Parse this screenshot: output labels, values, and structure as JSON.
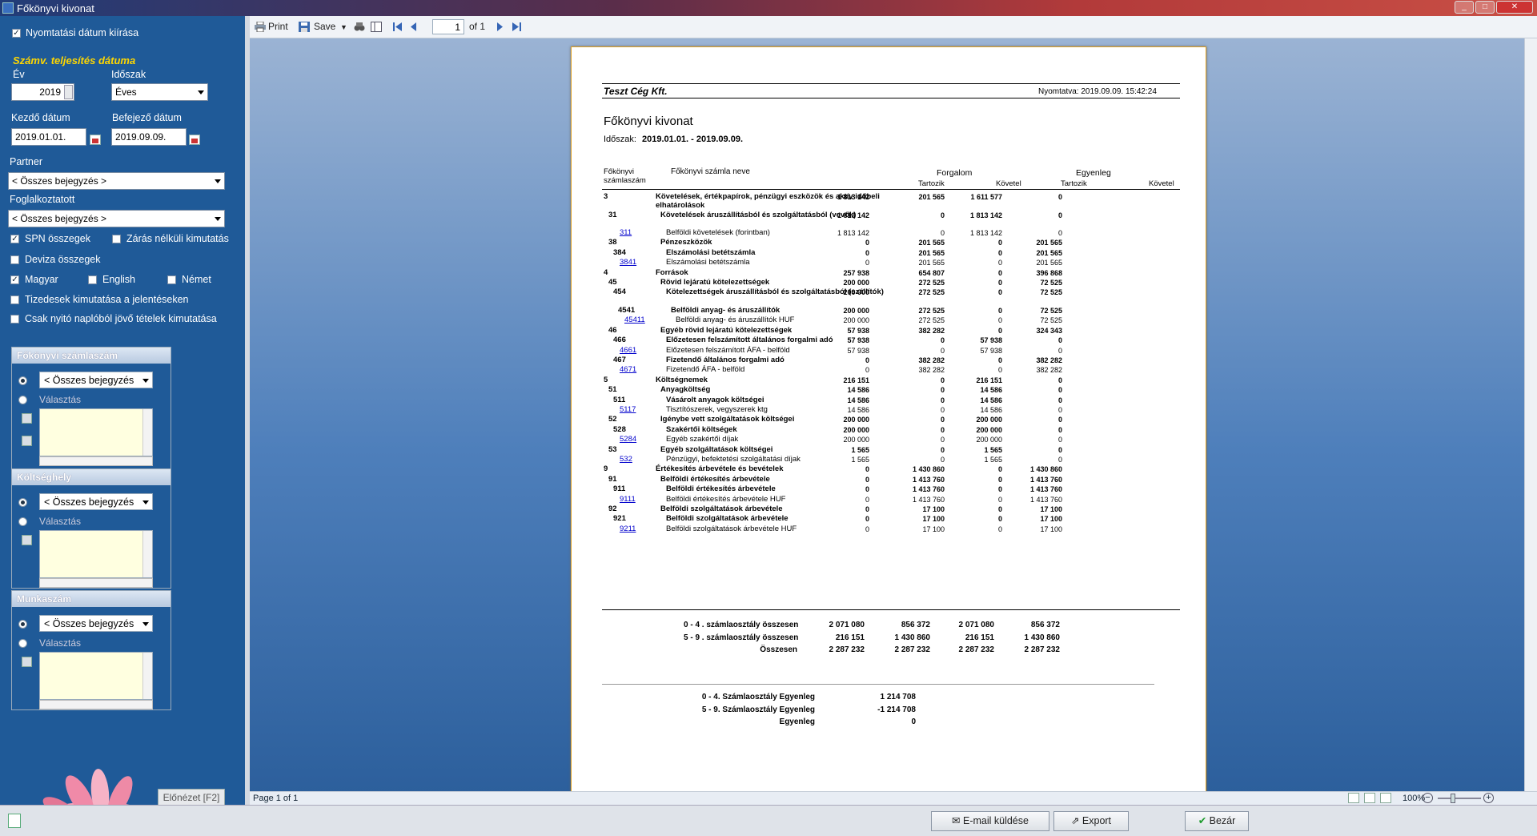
{
  "window": {
    "title": "Főkönyvi kivonat"
  },
  "left": {
    "print_date_label": "Nyomtatási dátum kiírása",
    "section_title": "Számv. teljesítés dátuma",
    "year_label": "Év",
    "year_value": "2019",
    "period_label": "Időszak",
    "period_value": "Éves",
    "start_label": "Kezdő dátum",
    "start_value": "2019.01.01.",
    "end_label": "Befejező dátum",
    "end_value": "2019.09.09.",
    "partner_label": "Partner",
    "partner_value": "< Összes bejegyzés >",
    "employee_label": "Foglalkoztatott",
    "employee_value": "< Összes bejegyzés >",
    "spn_label": "SPN összegek",
    "nonclose_label": "Zárás nélküli kimutatás",
    "currency_label": "Deviza összegek",
    "lang_hu": "Magyar",
    "lang_en": "English",
    "lang_de": "Német",
    "decimals_label": "Tizedesek kimutatása a jelentéseken",
    "opening_label": "Csak nyitó naplóból jövő tételek kimutatása",
    "groups": [
      {
        "title": "Főkönyvi számlaszám",
        "select": "< Összes bejegyzés",
        "choice": "Választás"
      },
      {
        "title": "Költséghely",
        "select": "< Összes bejegyzés",
        "choice": "Választás"
      },
      {
        "title": "Munkaszám",
        "select": "< Összes bejegyzés",
        "choice": "Választás"
      }
    ],
    "preview_button": "Előnézet [F2]"
  },
  "toolbar": {
    "print": "Print",
    "save": "Save",
    "page_value": "1",
    "page_of": "of 1"
  },
  "status": {
    "page": "Page 1 of 1",
    "zoom": "100%"
  },
  "report": {
    "company": "Teszt Cég Kft.",
    "printed": "Nyomtatva: 2019.09.09. 15:42:24",
    "title": "Főkönyvi kivonat",
    "period_label": "Időszak:",
    "period_value": "2019.01.01. - 2019.09.09.",
    "col_account": "Főkönyvi számlaszám",
    "col_name": "Főkönyvi számla neve",
    "col_turnover": "Forgalom",
    "col_balance": "Egyenleg",
    "col_debit": "Tartozik",
    "col_credit": "Követel",
    "rows": [
      {
        "code": "3",
        "name": "Követelések, értékpapírok, pénzügyi eszközök és aktív időbeli elhatárolások",
        "v": [
          "1 813 142",
          "201 565",
          "1 611 577",
          "0"
        ],
        "lvl": 0,
        "two": true
      },
      {
        "code": "31",
        "name": "Követelések áruszállításból és szolgáltatásból (vevők)",
        "v": [
          "1 813 142",
          "0",
          "1 813 142",
          "0"
        ],
        "lvl": 1,
        "two": true
      },
      {
        "code": "311",
        "name": "Belföldi követelések (forintban)",
        "v": [
          "1 813 142",
          "0",
          "1 813 142",
          "0"
        ],
        "lvl": 9
      },
      {
        "code": "38",
        "name": "Pénzeszközök",
        "v": [
          "0",
          "201 565",
          "0",
          "201 565"
        ],
        "lvl": 1
      },
      {
        "code": "384",
        "name": "Elszámolási betétszámla",
        "v": [
          "0",
          "201 565",
          "0",
          "201 565"
        ],
        "lvl": 2
      },
      {
        "code": "3841",
        "name": "Elszámolási betétszámla",
        "v": [
          "0",
          "201 565",
          "0",
          "201 565"
        ],
        "lvl": 9
      },
      {
        "code": "4",
        "name": "Források",
        "v": [
          "257 938",
          "654 807",
          "0",
          "396 868"
        ],
        "lvl": 0
      },
      {
        "code": "45",
        "name": "Rövid lejáratú kötelezettségek",
        "v": [
          "200 000",
          "272 525",
          "0",
          "72 525"
        ],
        "lvl": 1
      },
      {
        "code": "454",
        "name": "Kötelezettségek áruszállításból és szolgáltatásból (szállítók)",
        "v": [
          "200 000",
          "272 525",
          "0",
          "72 525"
        ],
        "lvl": 2,
        "two": true
      },
      {
        "code": "4541",
        "name": "Belföldi anyag- és áruszállítók",
        "v": [
          "200 000",
          "272 525",
          "0",
          "72 525"
        ],
        "lvl": 3
      },
      {
        "code": "45411",
        "name": "Belföldi anyag- és áruszállítók HUF",
        "v": [
          "200 000",
          "272 525",
          "0",
          "72 525"
        ],
        "lvl": 10
      },
      {
        "code": "46",
        "name": "Egyéb rövid lejáratú kötelezettségek",
        "v": [
          "57 938",
          "382 282",
          "0",
          "324 343"
        ],
        "lvl": 1
      },
      {
        "code": "466",
        "name": "Előzetesen felszámított általános forgalmi adó",
        "v": [
          "57 938",
          "0",
          "57 938",
          "0"
        ],
        "lvl": 2
      },
      {
        "code": "4661",
        "name": "Előzetesen felszámított ÁFA - belföld",
        "v": [
          "57 938",
          "0",
          "57 938",
          "0"
        ],
        "lvl": 9
      },
      {
        "code": "467",
        "name": "Fizetendő általános forgalmi adó",
        "v": [
          "0",
          "382 282",
          "0",
          "382 282"
        ],
        "lvl": 2
      },
      {
        "code": "4671",
        "name": "Fizetendő ÁFA - belföld",
        "v": [
          "0",
          "382 282",
          "0",
          "382 282"
        ],
        "lvl": 9
      },
      {
        "code": "5",
        "name": "Költségnemek",
        "v": [
          "216 151",
          "0",
          "216 151",
          "0"
        ],
        "lvl": 0
      },
      {
        "code": "51",
        "name": "Anyagköltség",
        "v": [
          "14 586",
          "0",
          "14 586",
          "0"
        ],
        "lvl": 1
      },
      {
        "code": "511",
        "name": "Vásárolt anyagok költségei",
        "v": [
          "14 586",
          "0",
          "14 586",
          "0"
        ],
        "lvl": 2
      },
      {
        "code": "5117",
        "name": "Tisztítószerek, vegyszerek ktg",
        "v": [
          "14 586",
          "0",
          "14 586",
          "0"
        ],
        "lvl": 9
      },
      {
        "code": "52",
        "name": "Igénybe vett szolgáltatások költségei",
        "v": [
          "200 000",
          "0",
          "200 000",
          "0"
        ],
        "lvl": 1
      },
      {
        "code": "528",
        "name": "Szakértői költségek",
        "v": [
          "200 000",
          "0",
          "200 000",
          "0"
        ],
        "lvl": 2
      },
      {
        "code": "5284",
        "name": "Egyéb szakértői díjak",
        "v": [
          "200 000",
          "0",
          "200 000",
          "0"
        ],
        "lvl": 9
      },
      {
        "code": "53",
        "name": "Egyéb szolgáltatások költségei",
        "v": [
          "1 565",
          "0",
          "1 565",
          "0"
        ],
        "lvl": 1
      },
      {
        "code": "532",
        "name": "Pénzügyi, befektetési szolgáltatási díjak",
        "v": [
          "1 565",
          "0",
          "1 565",
          "0"
        ],
        "lvl": 9
      },
      {
        "code": "9",
        "name": "Értékesítés árbevétele és bevételek",
        "v": [
          "0",
          "1 430 860",
          "0",
          "1 430 860"
        ],
        "lvl": 0
      },
      {
        "code": "91",
        "name": "Belföldi értékesítés árbevétele",
        "v": [
          "0",
          "1 413 760",
          "0",
          "1 413 760"
        ],
        "lvl": 1
      },
      {
        "code": "911",
        "name": "Belföldi értékesítés árbevétele",
        "v": [
          "0",
          "1 413 760",
          "0",
          "1 413 760"
        ],
        "lvl": 2
      },
      {
        "code": "9111",
        "name": "Belföldi értékesítés árbevétele HUF",
        "v": [
          "0",
          "1 413 760",
          "0",
          "1 413 760"
        ],
        "lvl": 9
      },
      {
        "code": "92",
        "name": "Belföldi szolgáltatások árbevétele",
        "v": [
          "0",
          "17 100",
          "0",
          "17 100"
        ],
        "lvl": 1
      },
      {
        "code": "921",
        "name": "Belföldi szolgáltatások árbevétele",
        "v": [
          "0",
          "17 100",
          "0",
          "17 100"
        ],
        "lvl": 2
      },
      {
        "code": "9211",
        "name": "Belföldi szolgáltatások árbevétele HUF",
        "v": [
          "0",
          "17 100",
          "0",
          "17 100"
        ],
        "lvl": 9
      }
    ],
    "totals": [
      {
        "label": "0 - 4 . számlaosztály összesen",
        "v": [
          "2 071 080",
          "856 372",
          "2 071 080",
          "856 372"
        ]
      },
      {
        "label": "5 - 9 . számlaosztály összesen",
        "v": [
          "216 151",
          "1 430 860",
          "216 151",
          "1 430 860"
        ]
      },
      {
        "label": "Összesen",
        "v": [
          "2 287 232",
          "2 287 232",
          "2 287 232",
          "2 287 232"
        ]
      }
    ],
    "balances": [
      {
        "label": "0 - 4. Számlaosztály Egyenleg",
        "v": "1 214 708"
      },
      {
        "label": "5 - 9. Számlaosztály Egyenleg",
        "v": "-1 214 708"
      },
      {
        "label": "Egyenleg",
        "v": "0"
      }
    ]
  },
  "bottom": {
    "email": "E-mail küldése",
    "export": "Export",
    "close": "Bezár"
  }
}
